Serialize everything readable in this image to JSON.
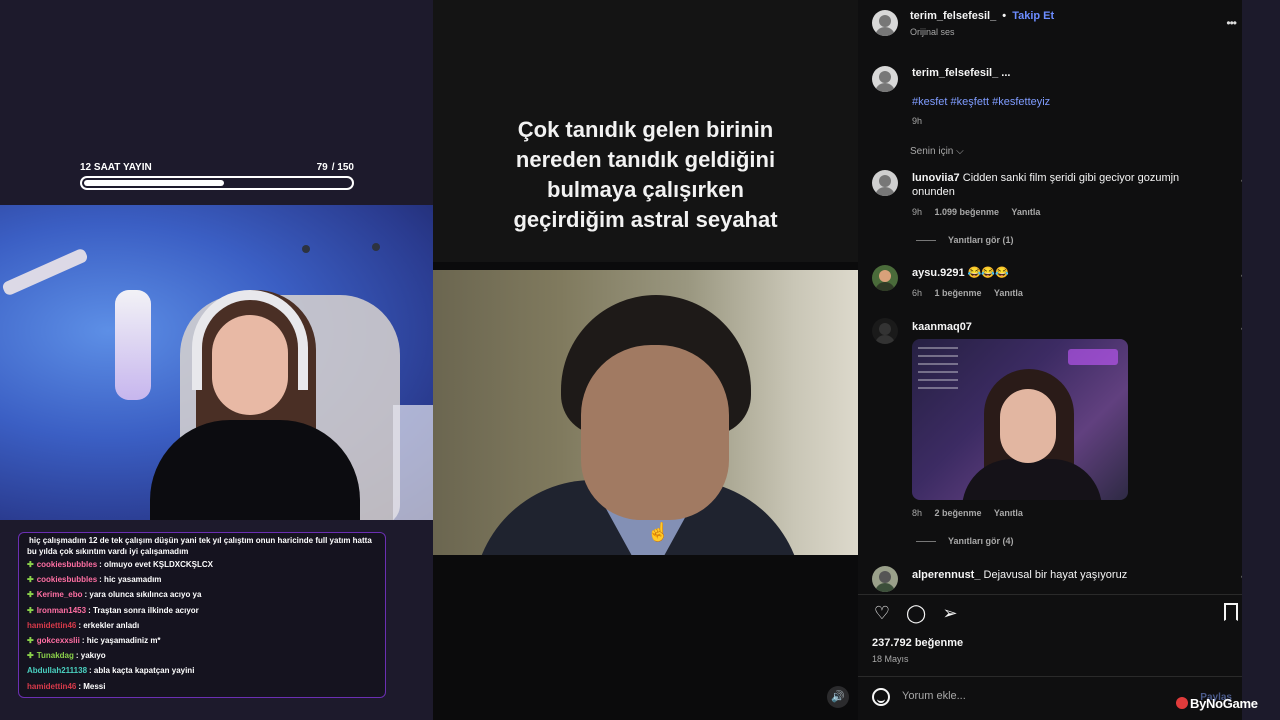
{
  "stream": {
    "goal_label": "12 SAAT YAYIN",
    "goal_current": "79",
    "goal_target": "/ 150",
    "goal_progress": 0.527
  },
  "chat": [
    {
      "user": "",
      "text": "hiç çalışmadım 12 de tek çalışım düşün yani tek yıl çalıştım onun haricinde full yatım hatta bu yılda çok sıkıntım vardı iyi çalışamadım",
      "color": "#ffffff",
      "plus": false,
      "wrap": true
    },
    {
      "user": "cookiesbubbles",
      "text": ": olmuyo evet KŞLDXCKŞLCX",
      "color": "#ff6fa3",
      "plus": true
    },
    {
      "user": "cookiesbubbles",
      "text": ": hic yasamadım",
      "color": "#ff6fa3",
      "plus": true
    },
    {
      "user": "Kerime_ebo",
      "text": ": yara olunca sıkılınca acıyo ya",
      "color": "#ff6fa3",
      "plus": true
    },
    {
      "user": "Ironman1453",
      "text": ": Traştan sonra ilkinde acıyor",
      "color": "#ff6fa3",
      "plus": true
    },
    {
      "user": "hamidettin46",
      "text": ": erkekler anladı",
      "color": "#d83a4a",
      "plus": false
    },
    {
      "user": "gokcexxslii",
      "text": ": hic yaşamadiniz m*",
      "color": "#ff6fa3",
      "plus": true
    },
    {
      "user": "Tunakdag",
      "text": ": yakıyo",
      "color": "#8ad14a",
      "plus": true
    },
    {
      "user": "Abdullah211138",
      "text": ": abla kaçta kapatçan yayini",
      "color": "#4ad1c0",
      "plus": false
    },
    {
      "user": "hamidettin46",
      "text": ": Messi",
      "color": "#d83a4a",
      "plus": false
    }
  ],
  "video": {
    "caption": [
      "Çok tanıdık gelen birinin",
      "nereden tanıdık geldiğini",
      "bulmaya çalışırken",
      "geçirdiğim astral seyahat"
    ],
    "sound_icon": "🔊"
  },
  "post": {
    "author": "terim_felsefesil_",
    "separator": "•",
    "follow_label": "Takip Et",
    "audio": "Orijinal ses",
    "caption_author": "terim_felsefesil_ ...",
    "hashtags": "#kesfet #keşfett #kesfetteyiz",
    "caption_time": "9h",
    "sort_label": "Senin için",
    "sort_icon": "⌵",
    "more_icon": "•••",
    "likes": "237.792 beğenme",
    "date": "18 Mayıs",
    "comment_placeholder": "Yorum ekle...",
    "post_label": "Paylaş"
  },
  "comments": [
    {
      "user": "lunoviia7",
      "text": "Cidden sanki film şeridi gibi geciyor gozumjn onunden",
      "time": "9h",
      "likes": "1.099 beğenme",
      "reply": "Yanıtla",
      "view_replies": "Yanıtları gör (1)"
    },
    {
      "user": "aysu.9291",
      "text": "😂😂😂",
      "time": "6h",
      "likes": "1 beğenme",
      "reply": "Yanıtla"
    },
    {
      "user": "kaanmaq07",
      "text": "",
      "time": "8h",
      "likes": "2 beğenme",
      "reply": "Yanıtla",
      "view_replies": "Yanıtları gör (4)"
    },
    {
      "user": "alperennust_",
      "text": "Dejavusal bir hayat yaşıyoruz"
    }
  ],
  "watermark": "ByNoGame"
}
